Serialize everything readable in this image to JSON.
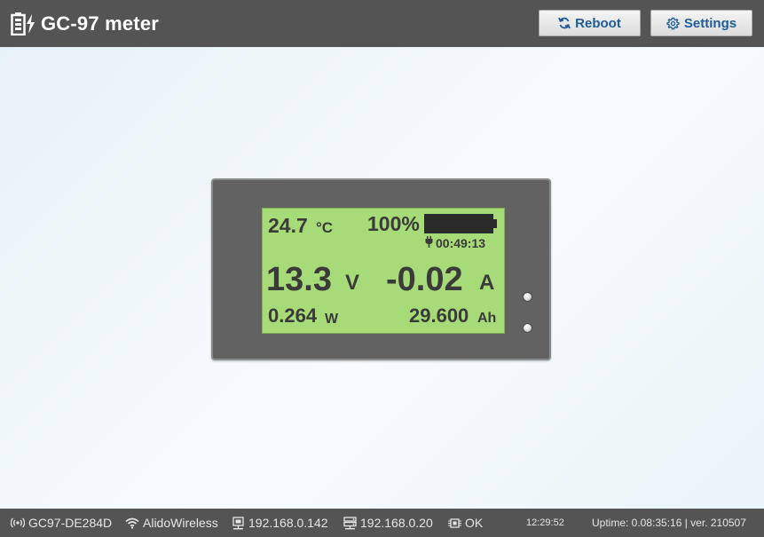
{
  "header": {
    "title": "GC-97 meter",
    "reboot_label": "Reboot",
    "settings_label": "Settings",
    "logo_icon": "battery-charge-icon"
  },
  "colors": {
    "header_bg": "#545454",
    "lcd_bg": "#a7db78",
    "lcd_text": "#3a3a3a",
    "button_text": "#1f5b96",
    "meter_body": "#626262"
  },
  "lcd": {
    "temperature": "24.7",
    "temperature_unit": "°C",
    "battery_percent": "100%",
    "battery_level": 1.0,
    "runtime": "00:49:13",
    "voltage": "13.3",
    "voltage_unit": "V",
    "current": "-0.02",
    "current_unit": "A",
    "power": "0.264",
    "power_unit": "W",
    "capacity": "29.600",
    "capacity_unit": "Ah"
  },
  "footer": {
    "device_id": "GC97-DE284D",
    "wifi_ssid": "AlidoWireless",
    "ip_address": "192.168.0.142",
    "gateway": "192.168.0.20",
    "status": "OK",
    "clock": "12:29:52",
    "uptime": "Uptime: 0.08:35:16 | ver. 210507"
  }
}
